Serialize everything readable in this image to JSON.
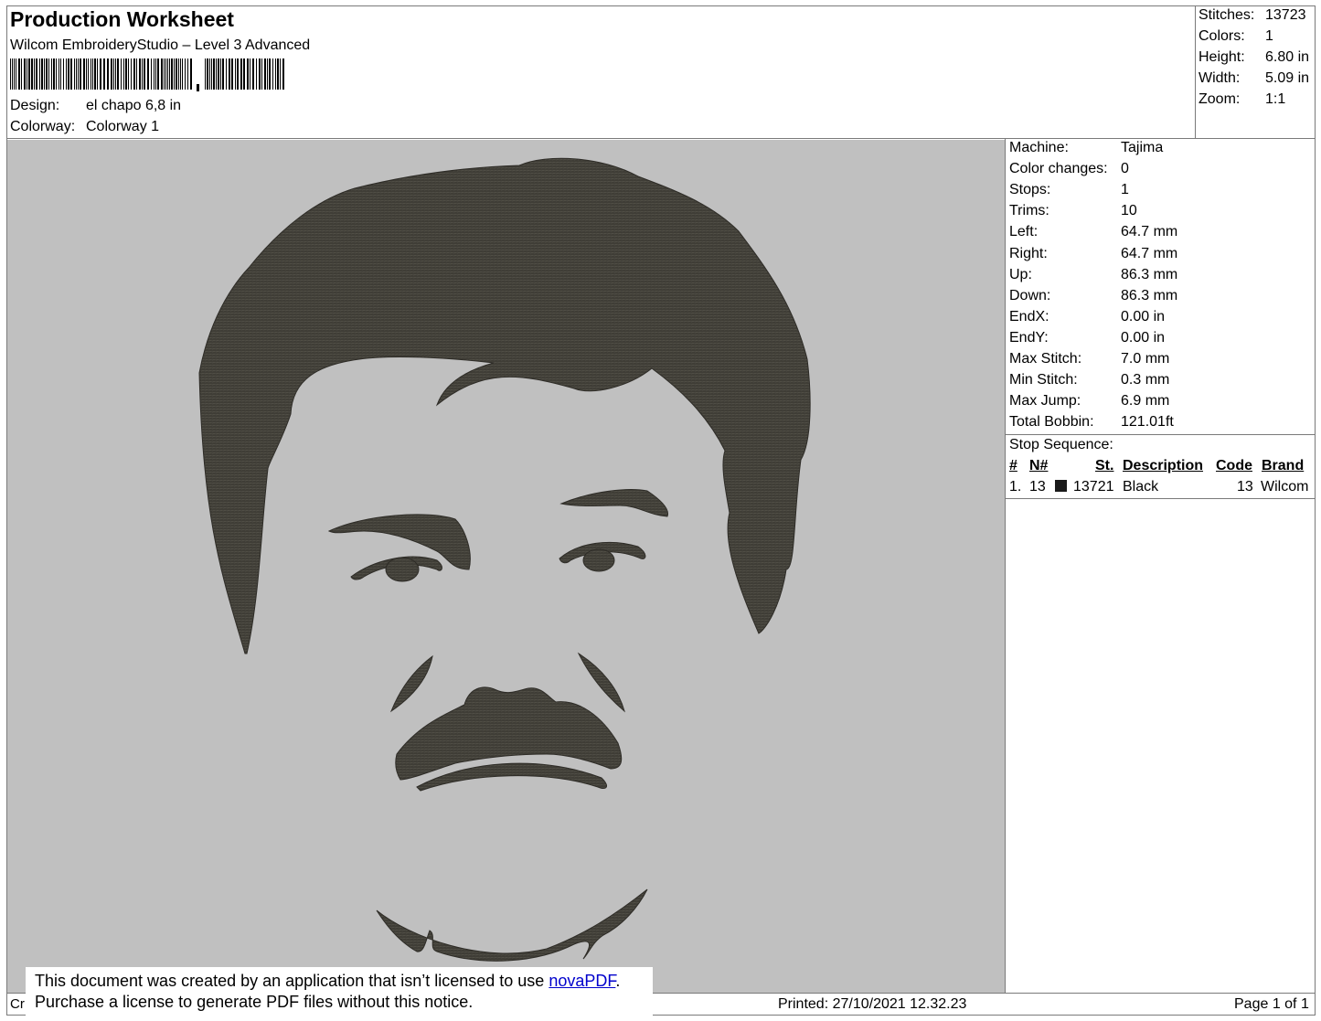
{
  "header": {
    "title": "Production Worksheet",
    "app": "Wilcom EmbroideryStudio – Level 3 Advanced",
    "design_label": "Design:",
    "design_value": "el chapo 6,8 in",
    "colorway_label": "Colorway:",
    "colorway_value": "Colorway 1"
  },
  "summary": [
    {
      "label": "Stitches:",
      "value": "13723"
    },
    {
      "label": "Colors:",
      "value": "1"
    },
    {
      "label": "Height:",
      "value": "6.80 in"
    },
    {
      "label": "Width:",
      "value": "5.09 in"
    },
    {
      "label": "Zoom:",
      "value": "1:1"
    }
  ],
  "machine_info": [
    {
      "label": "Machine:",
      "value": "Tajima"
    },
    {
      "label": "Color changes:",
      "value": "0"
    },
    {
      "label": "Stops:",
      "value": "1"
    },
    {
      "label": "Trims:",
      "value": "10"
    },
    {
      "label": "Left:",
      "value": "64.7 mm"
    },
    {
      "label": "Right:",
      "value": "64.7 mm"
    },
    {
      "label": "Up:",
      "value": "86.3 mm"
    },
    {
      "label": "Down:",
      "value": "86.3 mm"
    },
    {
      "label": "EndX:",
      "value": "0.00 in"
    },
    {
      "label": "EndY:",
      "value": "0.00 in"
    },
    {
      "label": "Max Stitch:",
      "value": "7.0 mm"
    },
    {
      "label": "Min Stitch:",
      "value": "0.3 mm"
    },
    {
      "label": "Max Jump:",
      "value": "6.9 mm"
    },
    {
      "label": "Total Bobbin:",
      "value": "121.01ft"
    }
  ],
  "stop_sequence": {
    "title": "Stop Sequence:",
    "headers": {
      "num": "#",
      "needle": "N#",
      "stitches": "St.",
      "description": "Description",
      "code": "Code",
      "brand": "Brand"
    },
    "rows": [
      {
        "num": "1.",
        "needle": "13",
        "swatch_color": "#1a1a1a",
        "stitches": "13721",
        "description": "Black",
        "code": "13",
        "brand": "Wilcom"
      }
    ]
  },
  "colors": {
    "background": "#c0c0c0",
    "thread": "#3f3d36",
    "link": "#0000cc"
  },
  "notice": {
    "line1_prefix": "This document was created by an application that isn’t licensed to use ",
    "link_text": "novaPDF",
    "line1_suffix": ".",
    "line2": "Purchase a license to generate PDF files without this notice."
  },
  "footer": {
    "left": "Cr",
    "printed": "Printed: 27/10/2021 12.32.23",
    "page": "Page 1 of 1"
  }
}
